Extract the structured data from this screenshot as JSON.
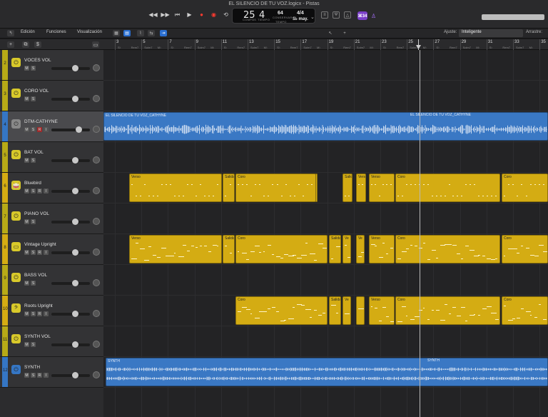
{
  "window": {
    "title": "EL SILENCIO DE TU VOZ.logicx - Pistas"
  },
  "lcd": {
    "bar": "25",
    "beat": "4",
    "bar_label": "COMPÁS",
    "beat_label": "TIEMPO",
    "tempo": "64",
    "tempo_label": "CONSERVAR",
    "tempo_sub": "TEMPO",
    "signature": "4/4",
    "key": "S♭ may."
  },
  "toolbar": {
    "badge": "⌘34"
  },
  "menubar": {
    "edit": "Edición",
    "functions": "Funciones",
    "view": "Visualización",
    "snap_label": "Ajuste:",
    "snap_value": "Inteligente",
    "drag_label": "Arrastre:"
  },
  "colors": {
    "yellow": "#d4ac13",
    "blue": "#3a78c4",
    "track_yellow": "#b7aa17",
    "track_blue": "#3576c4"
  },
  "tracks": [
    {
      "num": "2",
      "name": "VOCES VOL",
      "kind": "aux",
      "icon": "power-icon",
      "color": "#b7aa17",
      "fader": 0.62
    },
    {
      "num": "3",
      "name": "CORO VOL",
      "kind": "aux",
      "icon": "power-icon",
      "color": "#b7aa17",
      "fader": 0.62
    },
    {
      "num": "4",
      "name": "DTM-CATHYNE",
      "kind": "audio",
      "icon": "power-icon",
      "color": "#3576c4",
      "fader": 0.7,
      "selected": true
    },
    {
      "num": "5",
      "name": "BAT VOL",
      "kind": "aux",
      "icon": "power-icon",
      "color": "#b7aa17",
      "fader": 0.62
    },
    {
      "num": "6",
      "name": "Bluebird",
      "kind": "inst",
      "icon": "drum-icon",
      "color": "#d4ac13",
      "fader": 0.62
    },
    {
      "num": "7",
      "name": "PIANO VOL",
      "kind": "aux",
      "icon": "power-icon",
      "color": "#b7aa17",
      "fader": 0.62
    },
    {
      "num": "8",
      "name": "Vintage Upright",
      "kind": "inst",
      "icon": "piano-icon",
      "color": "#d4ac13",
      "fader": 0.62
    },
    {
      "num": "9",
      "name": "BASS VOL",
      "kind": "aux",
      "icon": "power-icon",
      "color": "#b7aa17",
      "fader": 0.62
    },
    {
      "num": "10",
      "name": "Roots Upright",
      "kind": "inst",
      "icon": "bass-icon",
      "color": "#d4ac13",
      "fader": 0.62
    },
    {
      "num": "11",
      "name": "SYNTH VOL",
      "kind": "aux",
      "icon": "power-icon",
      "color": "#b7aa17",
      "fader": 0.62
    },
    {
      "num": "12",
      "name": "SYNTH",
      "kind": "audio",
      "icon": "power-icon",
      "color": "#3576c4",
      "fader": 0.62
    }
  ],
  "ruler": {
    "bars": [
      "3",
      "5",
      "7",
      "9",
      "11",
      "13",
      "15",
      "17",
      "19",
      "21",
      "23",
      "25",
      "27",
      "29",
      "31",
      "33",
      "35"
    ],
    "chords": [
      "S♭",
      "Rem7",
      "Solm7",
      "M♭",
      "S♭",
      "Rem7",
      "Solm7",
      "M♭",
      "S♭",
      "Rem7",
      "Solm7",
      "M♭",
      "S♭",
      "Rem7",
      "Solm7",
      "M♭",
      "S♭",
      "Rem7",
      "Solm7",
      "M♭",
      "S♭",
      "Rem7",
      "Solm7",
      "M♭",
      "S♭",
      "Rem7",
      "Solm7",
      "M♭",
      "S♭",
      "Rem7",
      "Solm7",
      "M♭"
    ]
  },
  "regions": [
    {
      "lane": 2,
      "kind": "audio",
      "label": "EL SILENCIO DE TU VOZ_CATHYNE",
      "start": 0,
      "end": 623
    },
    {
      "lane": 2,
      "kind": "audio-label",
      "label": "EL SILENCIO DE TU VOZ_CATHYNE",
      "start": 430,
      "end": 623
    },
    {
      "lane": 4,
      "kind": "midi",
      "label": "Verso",
      "start": 36,
      "end": 166
    },
    {
      "lane": 4,
      "kind": "midi",
      "label": "Salida",
      "start": 167,
      "end": 184
    },
    {
      "lane": 4,
      "kind": "midi",
      "label": "Coro",
      "start": 185,
      "end": 298
    },
    {
      "lane": 4,
      "kind": "midi",
      "label": "",
      "start": 297,
      "end": 300
    },
    {
      "lane": 4,
      "kind": "midi",
      "label": "Salida",
      "start": 335,
      "end": 349
    },
    {
      "lane": 4,
      "kind": "midi",
      "label": "Verso",
      "start": 354,
      "end": 368
    },
    {
      "lane": 4,
      "kind": "midi",
      "label": "Verso",
      "start": 372,
      "end": 408
    },
    {
      "lane": 4,
      "kind": "midi",
      "label": "Coro",
      "start": 409,
      "end": 556
    },
    {
      "lane": 4,
      "kind": "midi",
      "label": "Coro",
      "start": 558,
      "end": 623
    },
    {
      "lane": 6,
      "kind": "midi",
      "label": "Verso",
      "start": 36,
      "end": 166
    },
    {
      "lane": 6,
      "kind": "midi",
      "label": "Salida",
      "start": 167,
      "end": 184
    },
    {
      "lane": 6,
      "kind": "midi",
      "label": "Coro",
      "start": 185,
      "end": 314
    },
    {
      "lane": 6,
      "kind": "midi",
      "label": "Salida",
      "start": 316,
      "end": 333
    },
    {
      "lane": 6,
      "kind": "midi",
      "label": "Ve",
      "start": 335,
      "end": 347
    },
    {
      "lane": 6,
      "kind": "midi",
      "label": "Ve",
      "start": 354,
      "end": 366
    },
    {
      "lane": 6,
      "kind": "midi",
      "label": "Verso",
      "start": 372,
      "end": 408
    },
    {
      "lane": 6,
      "kind": "midi",
      "label": "Coro",
      "start": 409,
      "end": 556
    },
    {
      "lane": 6,
      "kind": "midi",
      "label": "Coro",
      "start": 558,
      "end": 623
    },
    {
      "lane": 8,
      "kind": "midi",
      "label": "Coro",
      "start": 185,
      "end": 314
    },
    {
      "lane": 8,
      "kind": "midi",
      "label": "Salida",
      "start": 316,
      "end": 333
    },
    {
      "lane": 8,
      "kind": "midi",
      "label": "Ve",
      "start": 335,
      "end": 347
    },
    {
      "lane": 8,
      "kind": "midi",
      "label": "",
      "start": 354,
      "end": 366
    },
    {
      "lane": 8,
      "kind": "midi",
      "label": "Verso",
      "start": 372,
      "end": 408
    },
    {
      "lane": 8,
      "kind": "midi",
      "label": "Coro",
      "start": 409,
      "end": 556
    },
    {
      "lane": 8,
      "kind": "midi",
      "label": "Coro",
      "start": 558,
      "end": 623
    },
    {
      "lane": 10,
      "kind": "audio",
      "label": "SYNTH",
      "start": 3,
      "end": 623
    },
    {
      "lane": 10,
      "kind": "audio-label",
      "label": "SYNTH",
      "start": 454,
      "end": 623
    }
  ]
}
